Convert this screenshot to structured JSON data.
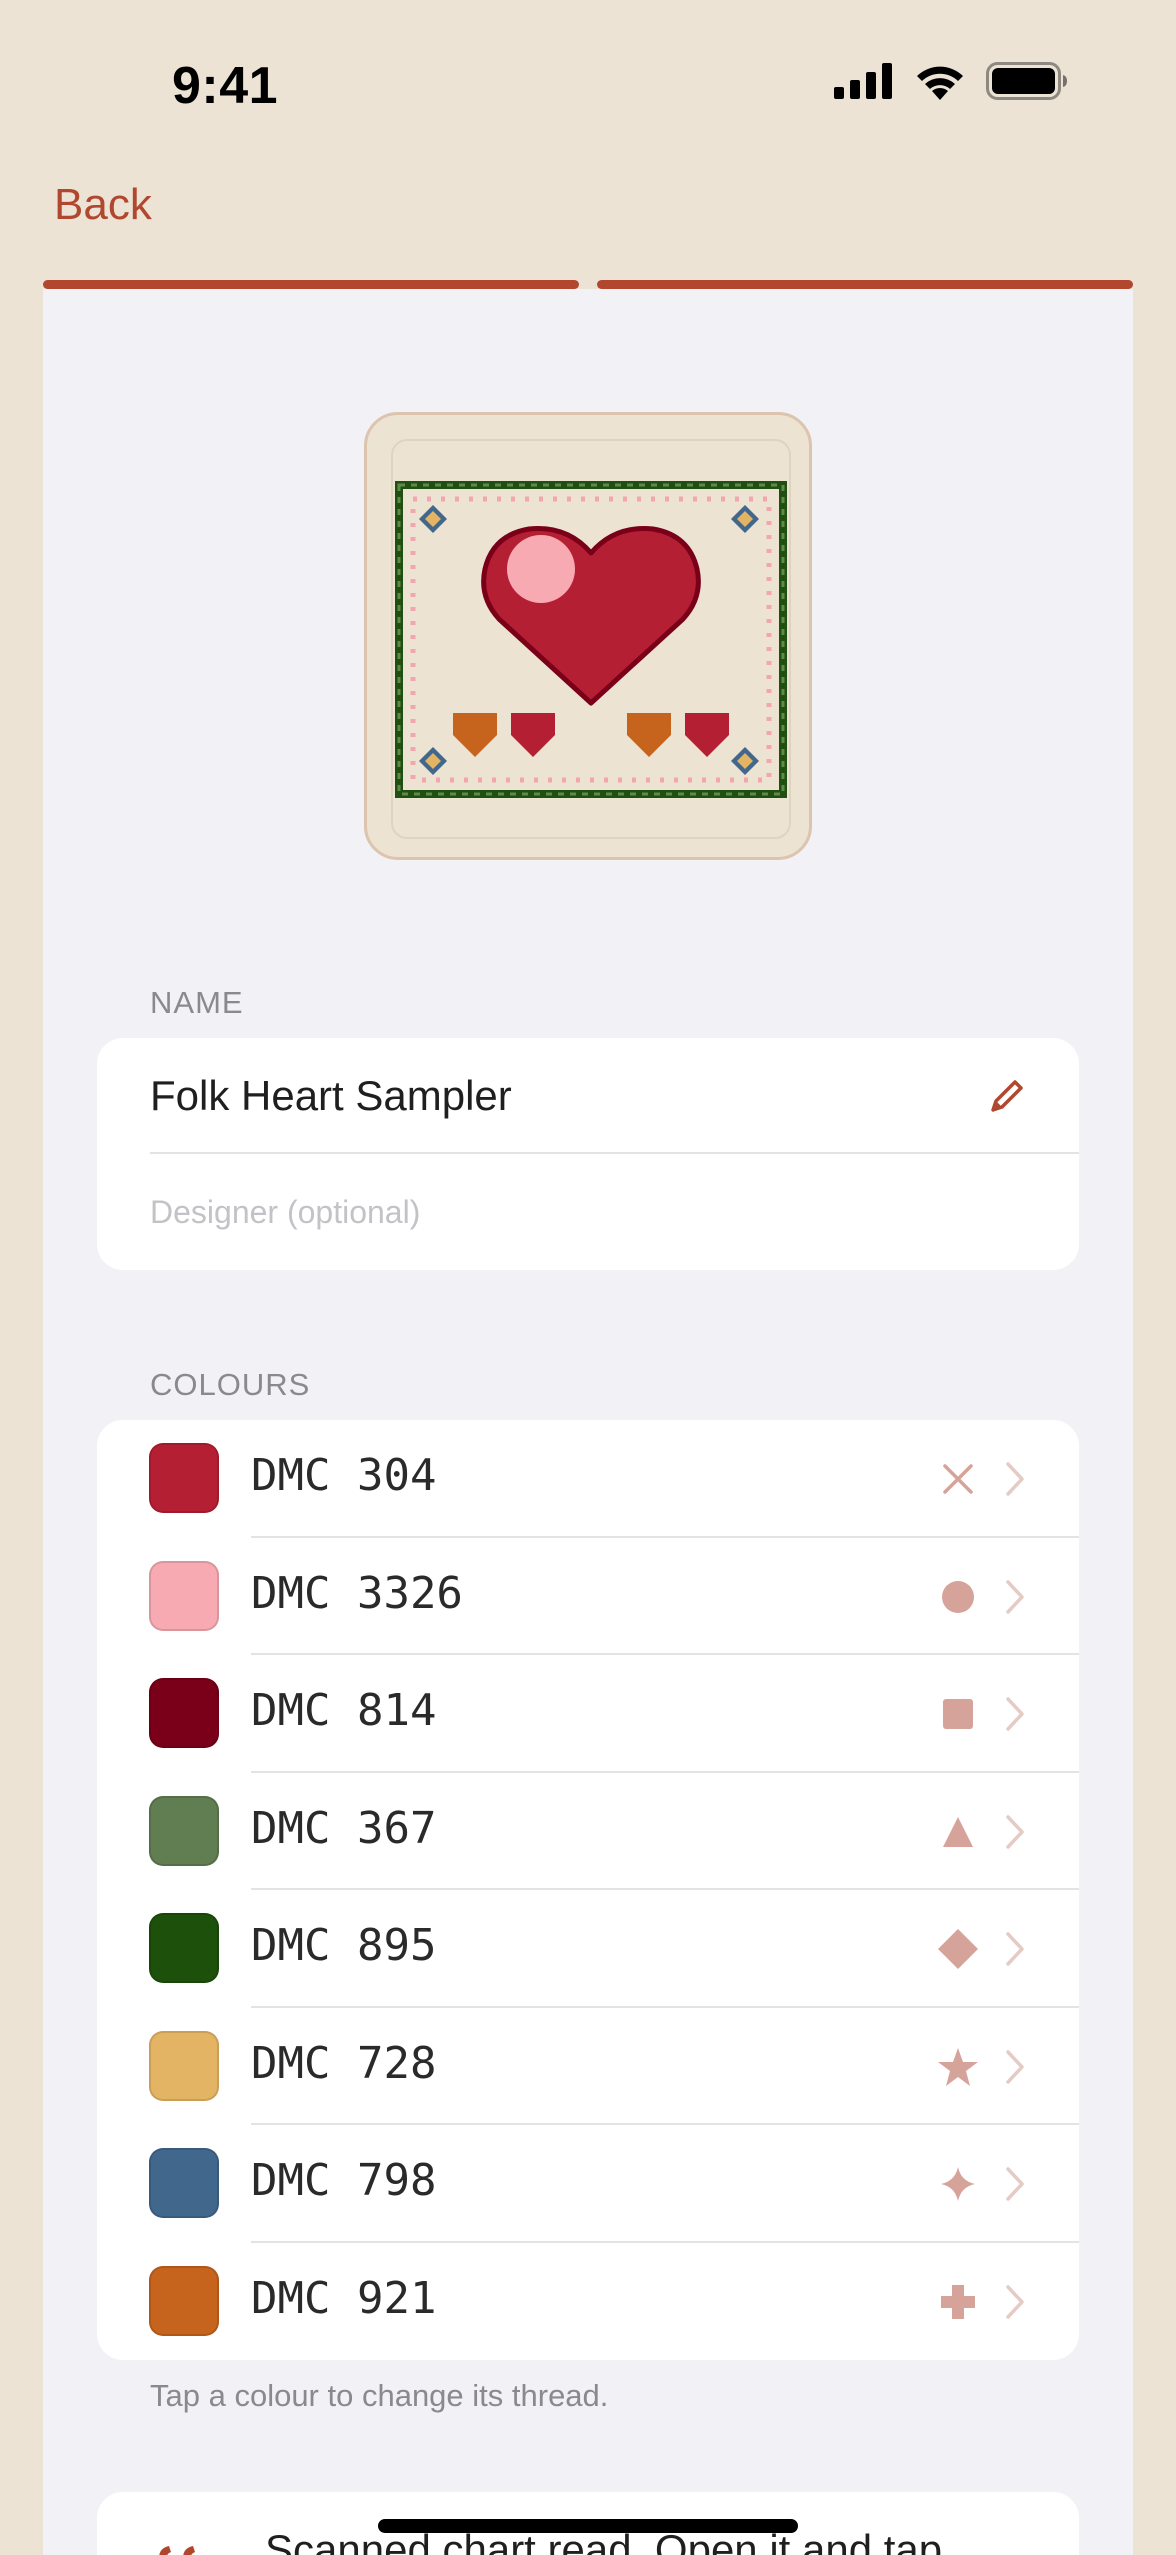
{
  "status_bar": {
    "time": "9:41"
  },
  "nav": {
    "back_label": "Back",
    "steps_total": 2,
    "steps_completed": 2
  },
  "pattern": {
    "preview_icon": "cross-stitch-heart-thumbnail"
  },
  "name_section": {
    "label": "NAME",
    "name_value": "Folk Heart Sampler",
    "designer_placeholder": "Designer (optional)",
    "designer_value": ""
  },
  "colours_section": {
    "label": "COLOURS",
    "hint": "Tap a colour to change its thread.",
    "items": [
      {
        "thread": "DMC 304",
        "color": "#b51f33",
        "symbol": "cross"
      },
      {
        "thread": "DMC 3326",
        "color": "#f8aab2",
        "symbol": "circle"
      },
      {
        "thread": "DMC 814",
        "color": "#7a0019",
        "symbol": "square"
      },
      {
        "thread": "DMC 367",
        "color": "#617d52",
        "symbol": "triangle"
      },
      {
        "thread": "DMC 895",
        "color": "#1d500a",
        "symbol": "diamond"
      },
      {
        "thread": "DMC 728",
        "color": "#e4b465",
        "symbol": "star"
      },
      {
        "thread": "DMC 798",
        "color": "#42678d",
        "symbol": "sparkle"
      },
      {
        "thread": "DMC 921",
        "color": "#c6641d",
        "symbol": "plus"
      }
    ]
  },
  "notice": {
    "text": "Scanned chart read. Open it and tap"
  },
  "colors": {
    "accent": "#b1472f",
    "background": "#ece3d5",
    "sheet": "#f2f1f6",
    "symbol": "#d6a39a"
  }
}
